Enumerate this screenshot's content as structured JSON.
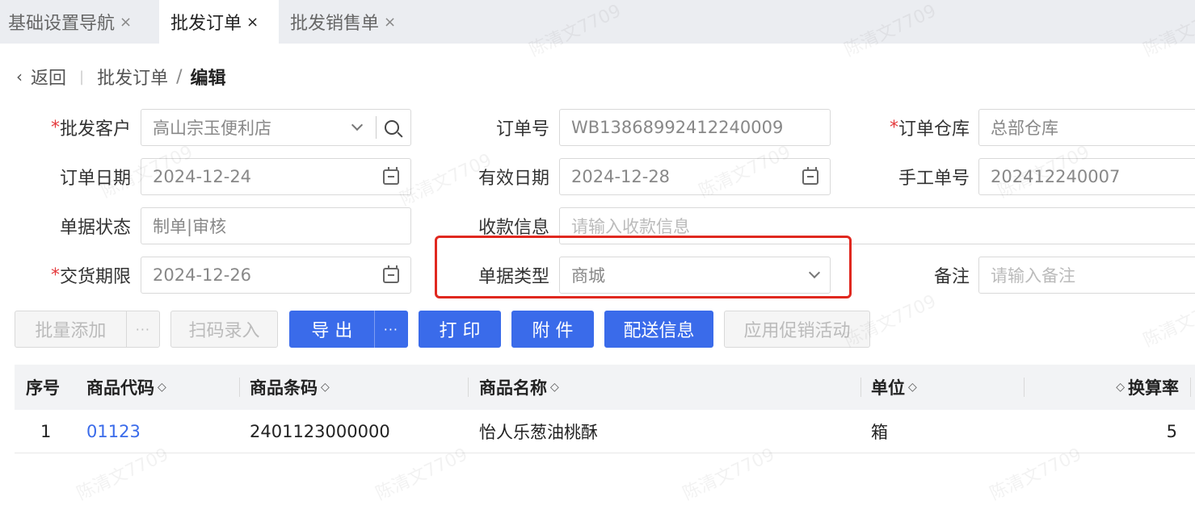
{
  "tabs": [
    {
      "label": "基础设置导航",
      "close": "×"
    },
    {
      "label": "批发订单",
      "close": "×"
    },
    {
      "label": "批发销售单",
      "close": "×"
    }
  ],
  "breadcrumb": {
    "back_label": "返回",
    "chevron": "‹",
    "parent": "批发订单",
    "slash": "/",
    "current": "编辑"
  },
  "form": {
    "customer_label": "批发客户",
    "customer_value": "高山宗玉便利店",
    "order_no_label": "订单号",
    "order_no_value": "WB13868992412240009",
    "warehouse_label": "订单仓库",
    "warehouse_value": "总部仓库",
    "order_date_label": "订单日期",
    "order_date_value": "2024-12-24",
    "valid_date_label": "有效日期",
    "valid_date_value": "2024-12-28",
    "manual_no_label": "手工单号",
    "manual_no_value": "202412240007",
    "status_label": "单据状态",
    "status_value": "制单|审核",
    "payment_label": "收款信息",
    "payment_placeholder": "请输入收款信息",
    "delivery_label": "交货期限",
    "delivery_value": "2024-12-26",
    "doc_type_label": "单据类型",
    "doc_type_value": "商城",
    "remark_label": "备注",
    "remark_placeholder": "请输入备注",
    "required_mark": "*"
  },
  "toolbar": {
    "batch_add": "批量添加",
    "scan_entry": "扫码录入",
    "export": "导 出",
    "print": "打 印",
    "attachment": "附 件",
    "delivery_info": "配送信息",
    "apply_promo": "应用促销活动",
    "more": "···"
  },
  "table": {
    "headers": {
      "seq": "序号",
      "code": "商品代码",
      "barcode": "商品条码",
      "name": "商品名称",
      "unit": "单位",
      "rate": "换算率"
    },
    "sort_glyph": "◇",
    "rows": [
      {
        "seq": "1",
        "code": "01123",
        "barcode": "2401123000000",
        "name": "怡人乐葱油桃酥",
        "unit": "箱",
        "rate": "5"
      }
    ]
  },
  "watermark": "陈清文7709",
  "colors": {
    "primary": "#3a6bea",
    "highlight": "#e0281f",
    "required": "#e4393c"
  }
}
